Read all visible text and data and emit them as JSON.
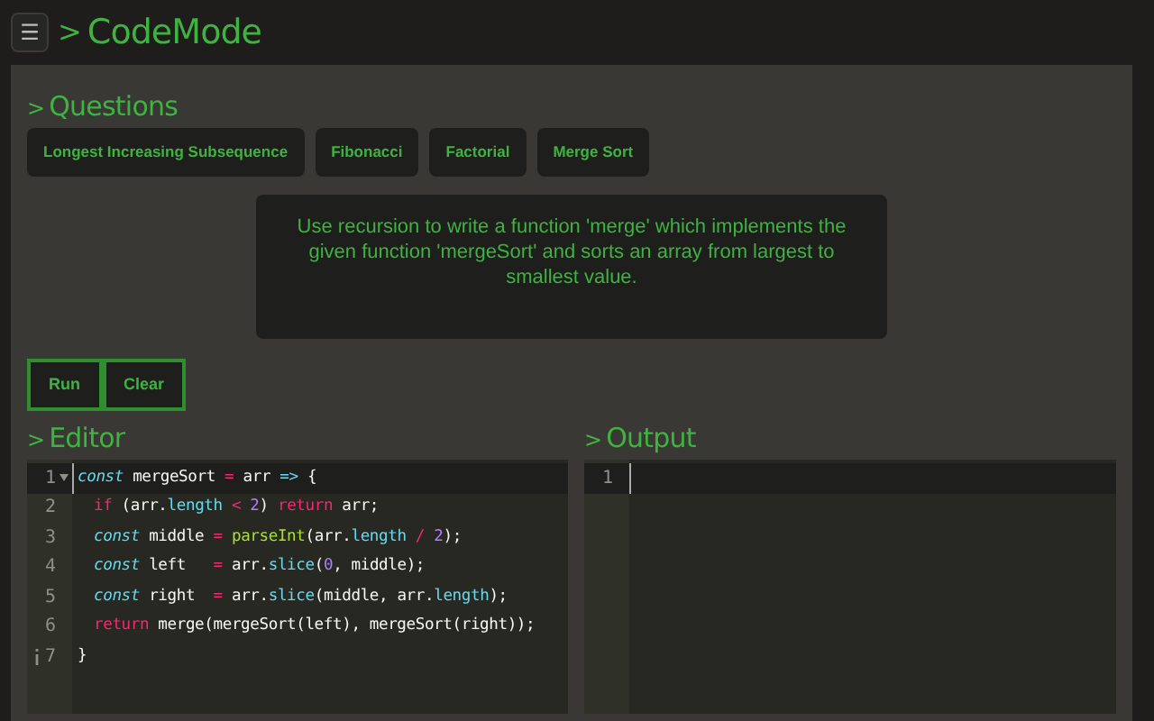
{
  "header": {
    "menu_glyph": "☰",
    "prompt": ">",
    "title": "CodeMode"
  },
  "questions": {
    "prompt": ">",
    "heading": "Questions",
    "items": [
      {
        "label": "Longest Increasing Subsequence"
      },
      {
        "label": "Fibonacci"
      },
      {
        "label": "Factorial"
      },
      {
        "label": "Merge Sort"
      }
    ],
    "description": "Use recursion to write a function 'merge' which implements the given function 'mergeSort' and sorts an array from largest to smallest value."
  },
  "actions": [
    "Run",
    "Clear"
  ],
  "editor": {
    "prompt": ">",
    "heading": "Editor",
    "lines": [
      {
        "number": "1",
        "active": true,
        "foldable": true,
        "annotated": false,
        "indented": false,
        "tokens": [
          {
            "text": "const",
            "kind": "storage"
          },
          {
            "text": " mergeSort ",
            "kind": "plain"
          },
          {
            "text": "=",
            "kind": "operator"
          },
          {
            "text": " arr ",
            "kind": "plain"
          },
          {
            "text": "=>",
            "kind": "storage"
          },
          {
            "text": " {",
            "kind": "plain"
          }
        ]
      },
      {
        "number": "2",
        "active": false,
        "foldable": false,
        "annotated": false,
        "indented": true,
        "tokens": [
          {
            "text": "if",
            "kind": "keyword"
          },
          {
            "text": " (arr.",
            "kind": "plain"
          },
          {
            "text": "length",
            "kind": "property"
          },
          {
            "text": " < ",
            "kind": "operator"
          },
          {
            "text": "2",
            "kind": "number"
          },
          {
            "text": ") ",
            "kind": "plain"
          },
          {
            "text": "return",
            "kind": "keyword"
          },
          {
            "text": " arr;",
            "kind": "plain"
          }
        ]
      },
      {
        "number": "3",
        "active": false,
        "foldable": false,
        "annotated": false,
        "indented": true,
        "tokens": [
          {
            "text": "const",
            "kind": "storage"
          },
          {
            "text": " middle ",
            "kind": "plain"
          },
          {
            "text": "= ",
            "kind": "operator"
          },
          {
            "text": "parseInt",
            "kind": "function"
          },
          {
            "text": "(arr.",
            "kind": "plain"
          },
          {
            "text": "length",
            "kind": "property"
          },
          {
            "text": " / ",
            "kind": "operator"
          },
          {
            "text": "2",
            "kind": "number"
          },
          {
            "text": ");",
            "kind": "plain"
          }
        ]
      },
      {
        "number": "4",
        "active": false,
        "foldable": false,
        "annotated": false,
        "indented": true,
        "tokens": [
          {
            "text": "const",
            "kind": "storage"
          },
          {
            "text": " left   ",
            "kind": "plain"
          },
          {
            "text": "=",
            "kind": "operator"
          },
          {
            "text": " arr.",
            "kind": "plain"
          },
          {
            "text": "slice",
            "kind": "property"
          },
          {
            "text": "(",
            "kind": "plain"
          },
          {
            "text": "0",
            "kind": "number"
          },
          {
            "text": ", middle);",
            "kind": "plain"
          }
        ]
      },
      {
        "number": "5",
        "active": false,
        "foldable": false,
        "annotated": false,
        "indented": true,
        "tokens": [
          {
            "text": "const",
            "kind": "storage"
          },
          {
            "text": " right  ",
            "kind": "plain"
          },
          {
            "text": "=",
            "kind": "operator"
          },
          {
            "text": " arr.",
            "kind": "plain"
          },
          {
            "text": "slice",
            "kind": "property"
          },
          {
            "text": "(middle, arr.",
            "kind": "plain"
          },
          {
            "text": "length",
            "kind": "property"
          },
          {
            "text": ");",
            "kind": "plain"
          }
        ]
      },
      {
        "number": "6",
        "active": false,
        "foldable": false,
        "annotated": false,
        "indented": true,
        "tokens": [
          {
            "text": "return",
            "kind": "keyword"
          },
          {
            "text": " merge(mergeSort(left), mergeSort(right));",
            "kind": "plain"
          }
        ]
      },
      {
        "number": "7",
        "active": false,
        "foldable": false,
        "annotated": true,
        "indented": false,
        "tokens": [
          {
            "text": "}",
            "kind": "plain"
          }
        ]
      }
    ]
  },
  "output": {
    "prompt": ">",
    "heading": "Output",
    "lines": [
      {
        "number": "1",
        "active": true
      }
    ]
  }
}
